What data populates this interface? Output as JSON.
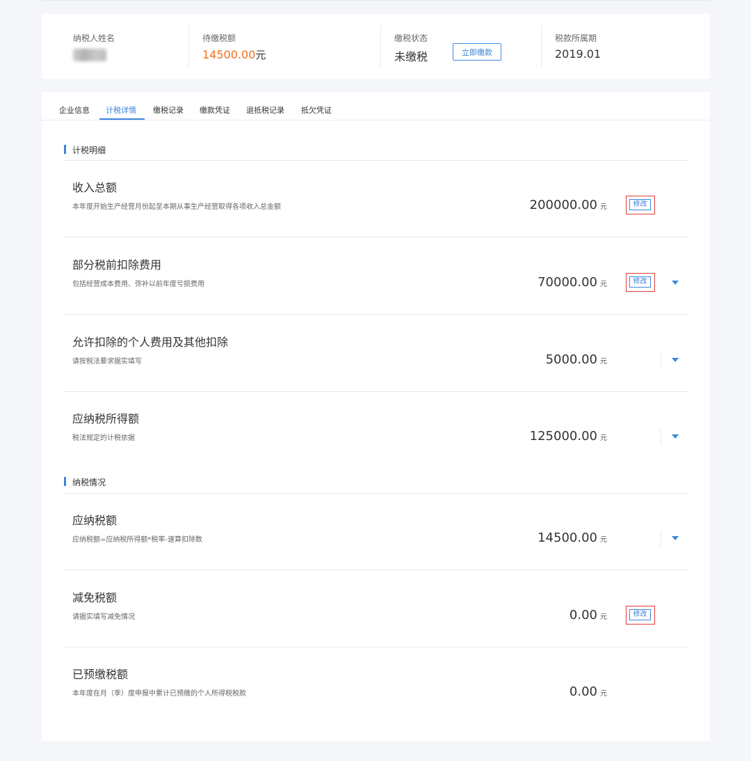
{
  "summary": {
    "taxpayer_name_label": "纳税人姓名",
    "taxpayer_name_value": "",
    "pending_tax_label": "待缴税额",
    "pending_tax_amount": "14500.00",
    "pending_tax_unit": "元",
    "tax_status_label": "缴税状态",
    "tax_status_value": "未缴税",
    "pay_now_button": "立即缴款",
    "tax_period_label": "税款所属期",
    "tax_period_value": "2019.01"
  },
  "colors": {
    "accent": "#3a86e0",
    "amount_orange": "#f56c1a",
    "status_red": "#f04a3a",
    "highlight_box": "#e03a3a"
  },
  "tabs": [
    {
      "label": "企业信息",
      "active": false
    },
    {
      "label": "计税详情",
      "active": true
    },
    {
      "label": "缴税记录",
      "active": false
    },
    {
      "label": "缴款凭证",
      "active": false
    },
    {
      "label": "退抵税记录",
      "active": false
    },
    {
      "label": "抵欠凭证",
      "active": false
    }
  ],
  "sections": {
    "calc_detail": "计税明细",
    "tax_situation": "纳税情况"
  },
  "rows": [
    {
      "title": "收入总额",
      "desc": "本年度开始生产经营月份起至本期从事生产经营取得各项收入总金额",
      "value": "200000.00",
      "unit": "元",
      "edit": "修改",
      "expand": false
    },
    {
      "title": "部分税前扣除费用",
      "desc": "包括经营成本费用、弥补以前年度亏损费用",
      "value": "70000.00",
      "unit": "元",
      "edit": "修改",
      "expand": true
    },
    {
      "title": "允许扣除的个人费用及其他扣除",
      "desc": "请按税法要求据实填写",
      "value": "5000.00",
      "unit": "元",
      "edit": null,
      "expand": true
    },
    {
      "title": "应纳税所得额",
      "desc": "税法规定的计税依据",
      "value": "125000.00",
      "unit": "元",
      "edit": null,
      "expand": true
    },
    {
      "title": "应纳税额",
      "desc": "应纳税额=应纳税所得额*税率-速算扣除数",
      "value": "14500.00",
      "unit": "元",
      "edit": null,
      "expand": true
    },
    {
      "title": "减免税额",
      "desc": "请据实填写减免情况",
      "value": "0.00",
      "unit": "元",
      "edit": "修改",
      "expand": false
    },
    {
      "title": "已预缴税额",
      "desc": "本年度在月（季）度申报中累计已预缴的个人所得税税款",
      "value": "0.00",
      "unit": "元",
      "edit": null,
      "expand": false
    }
  ]
}
